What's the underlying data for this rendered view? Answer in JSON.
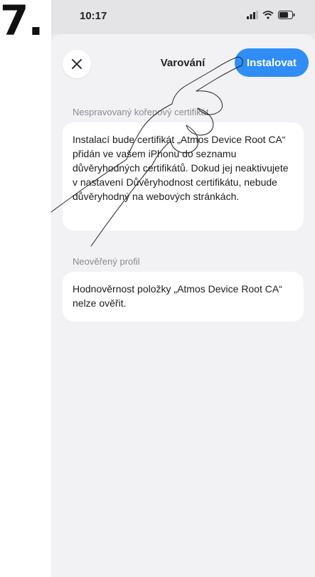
{
  "step_number": "7.",
  "status_bar": {
    "time": "10:17"
  },
  "header": {
    "title": "Varování",
    "install_label": "Instalovat"
  },
  "sections": [
    {
      "label": "Nespravovaný kořenový certifikát",
      "body": "Instalací bude certifikát „Atmos Device Root CA“ přidán ve vašem iPhonu do seznamu důvěryhodných certifikátů. Dokud jej neaktivujete v nastavení Důvěryhodnost certifikátu, nebude důvěryhodný na webových stránkách."
    },
    {
      "label": "Neověřený profil",
      "body": "Hodnověrnost položky „Atmos Device Root CA“ nelze ověřit."
    }
  ],
  "colors": {
    "accent": "#2f8df5",
    "sheet_background": "#f2f2f4",
    "section_label": "#8a8a8f"
  },
  "icons": [
    "close-icon",
    "signal-icon",
    "wifi-icon",
    "battery-icon",
    "pointing-hand-icon"
  ]
}
